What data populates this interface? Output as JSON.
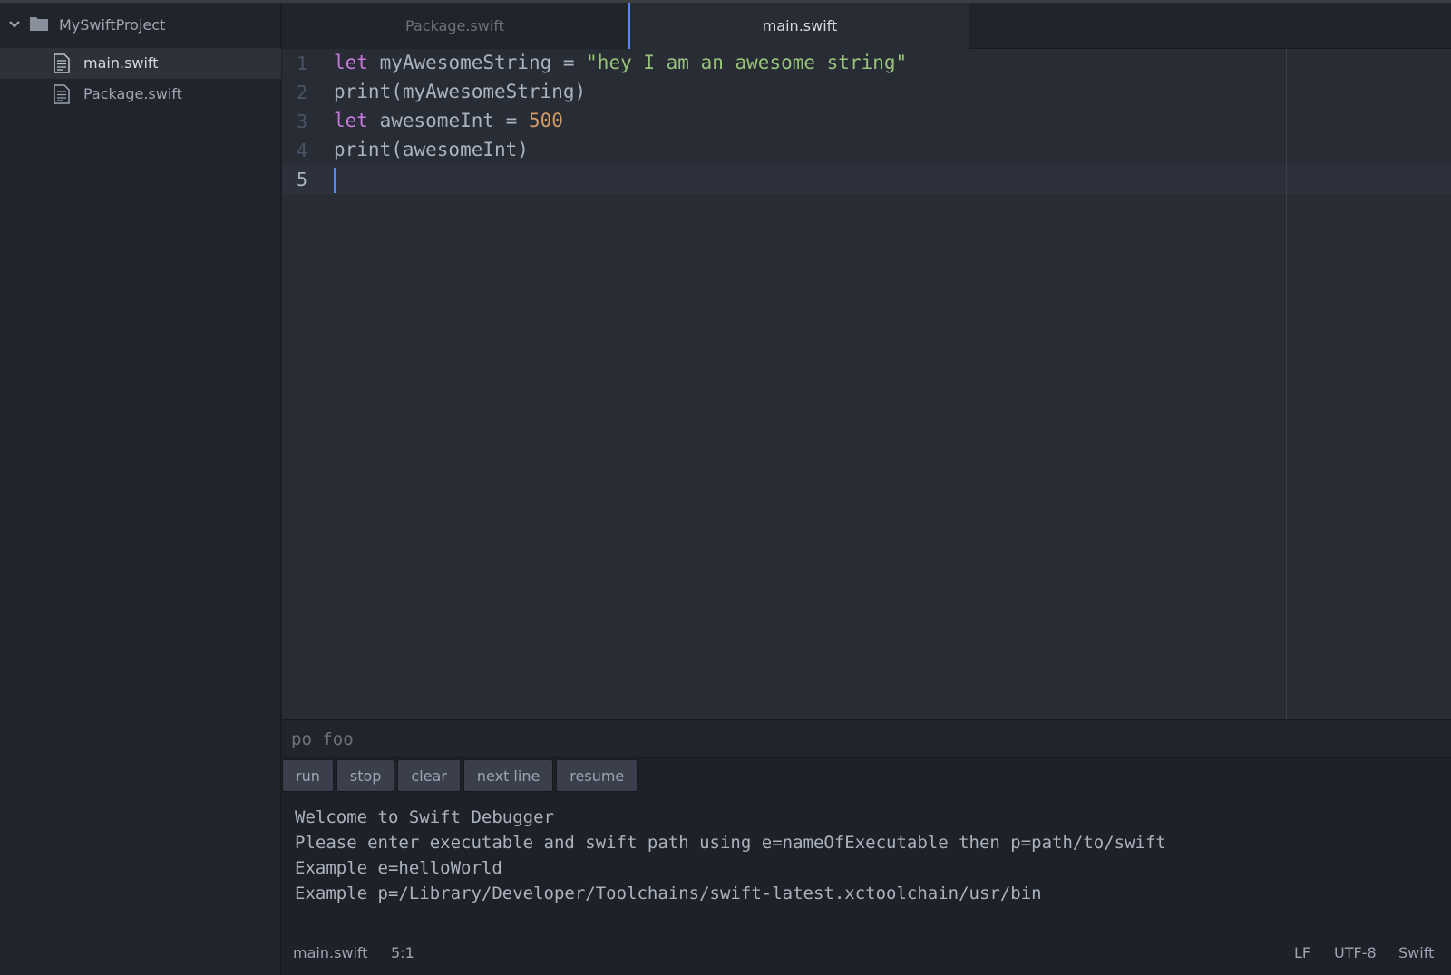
{
  "sidebar": {
    "project_name": "MySwiftProject",
    "files": [
      {
        "label": "main.swift"
      },
      {
        "label": "Package.swift"
      }
    ]
  },
  "tabs": [
    {
      "label": "Package.swift"
    },
    {
      "label": "main.swift"
    }
  ],
  "editor": {
    "line_numbers": [
      "1",
      "2",
      "3",
      "4",
      "5"
    ],
    "lines": [
      {
        "kw": "let",
        "rest": " myAwesomeString = ",
        "str": "\"hey I am an awesome string\""
      },
      {
        "text": "print(myAwesomeString)"
      },
      {
        "kw": "let",
        "rest": " awesomeInt = ",
        "num": "500"
      },
      {
        "text": "print(awesomeInt)"
      },
      {
        "text": ""
      }
    ]
  },
  "debugger": {
    "input_value": "po foo",
    "buttons": [
      "run",
      "stop",
      "clear",
      "next line",
      "resume"
    ],
    "console": [
      "Welcome to Swift Debugger",
      "Please enter executable and swift path using e=nameOfExecutable then p=path/to/swift",
      "Example e=helloWorld",
      "Example p=/Library/Developer/Toolchains/swift-latest.xctoolchain/usr/bin"
    ]
  },
  "status": {
    "file": "main.swift",
    "cursor": "5:1",
    "line_ending": "LF",
    "encoding": "UTF-8",
    "grammar": "Swift"
  },
  "colors": {
    "accent": "#568af2",
    "keyword": "#c678dd",
    "string": "#98c379",
    "number": "#d19a66"
  },
  "icons": {
    "tree_toggle": "chevron-down-icon",
    "project": "folder-icon",
    "file": "file-text-icon"
  }
}
